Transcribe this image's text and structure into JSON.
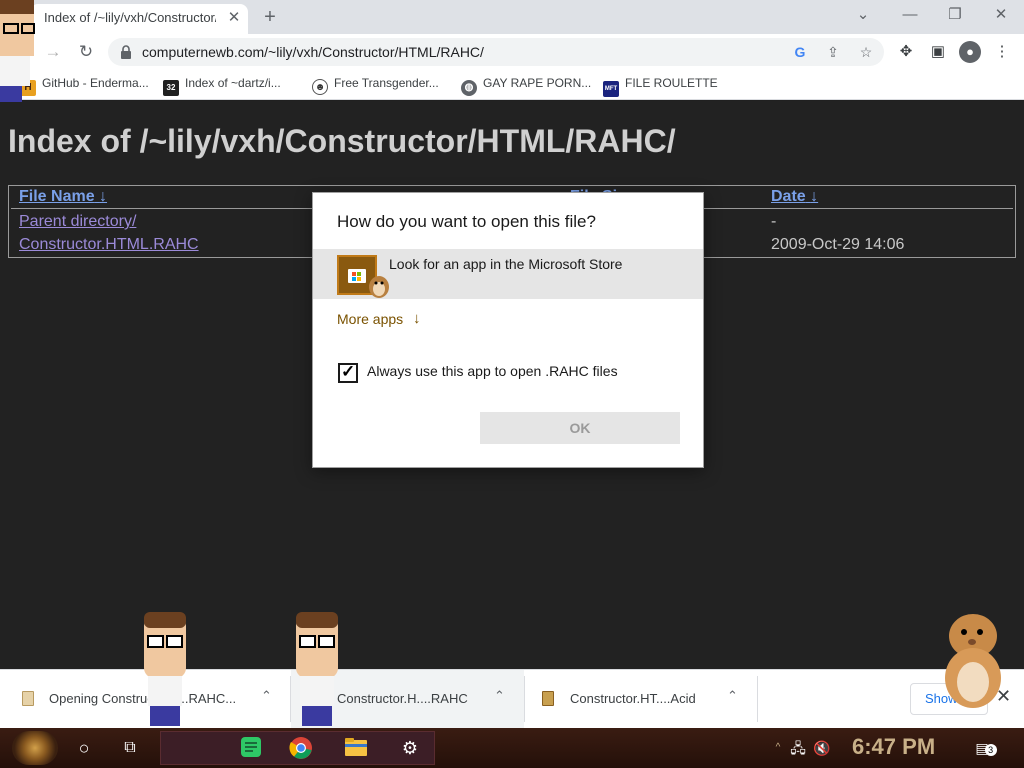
{
  "browser": {
    "tab_title": "Index of /~lily/vxh/Constructor/HTML/RAHC/",
    "url": "computernewb.com/~lily/vxh/Constructor/HTML/RAHC/",
    "bookmarks": [
      {
        "label": "GitHub - Enderma...",
        "icon": "H"
      },
      {
        "label": "Index of ~dartz/i...",
        "icon": "32"
      },
      {
        "label": "Free Transgender...",
        "icon": "mask"
      },
      {
        "label": "GAY RAPE PORN...",
        "icon": "globe"
      },
      {
        "label": "FILE ROULETTE",
        "icon": "MFT"
      }
    ]
  },
  "page": {
    "title": "Index of /~lily/vxh/Constructor/HTML/RAHC/",
    "columns": {
      "name": "File Name",
      "name_sort": "↓",
      "size": "File Size",
      "date": "Date",
      "date_sort": "↓"
    },
    "rows": [
      {
        "name": "Parent directory/",
        "date": "-"
      },
      {
        "name": "Constructor.HTML.RAHC",
        "date": "2009-Oct-29 14:06"
      }
    ]
  },
  "dialog": {
    "title": "How do you want to open this file?",
    "store_option": "Look for an app in the Microsoft Store",
    "more_apps": "More apps",
    "more_apps_arrow": "↓",
    "always_use": "Always use this app to open .RAHC files",
    "always_checked": true,
    "ok": "OK"
  },
  "downloads": {
    "items": [
      {
        "name": "Opening Construct...H...RAHC..."
      },
      {
        "name": "Constructor.H....RAHC"
      },
      {
        "name": "Constructor.HT....Acid"
      }
    ],
    "show_all": "Show all"
  },
  "taskbar": {
    "clock": "6:47 PM",
    "notification_count": "3"
  }
}
